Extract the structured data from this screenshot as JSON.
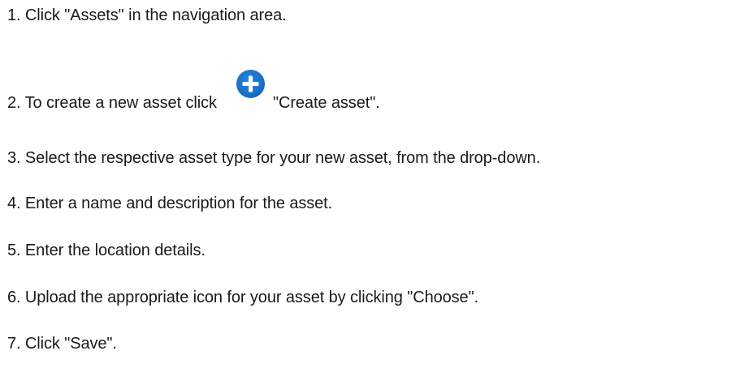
{
  "steps": [
    {
      "text": "1. Click \"Assets\" in the navigation area."
    },
    {
      "text_before": "2. To create a new asset click",
      "text_after": "\"Create asset\".",
      "icon": "plus-circle-icon",
      "icon_color": "#1c78d0"
    },
    {
      "text": "3. Select the respective asset type for your new asset, from the drop-down."
    },
    {
      "text": "4. Enter a name and description for the asset."
    },
    {
      "text": "5. Enter the location details."
    },
    {
      "text": "6. Upload the appropriate icon for your asset by clicking \"Choose\"."
    },
    {
      "text": "7. Click \"Save\"."
    }
  ]
}
